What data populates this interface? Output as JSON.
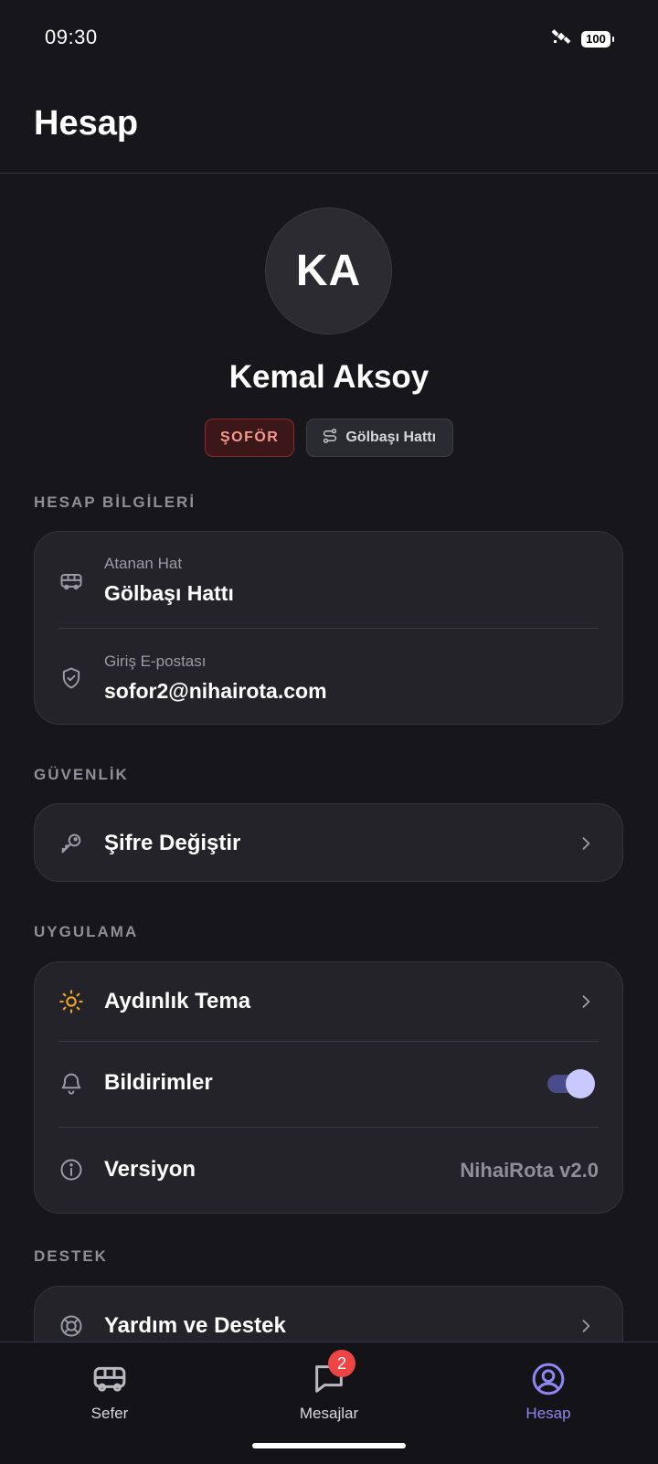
{
  "status_bar": {
    "time": "09:30",
    "battery": "100"
  },
  "header": {
    "title": "Hesap"
  },
  "profile": {
    "initials": "KA",
    "name": "Kemal Aksoy",
    "role_badge": "ŞOFÖR",
    "line_badge": "Gölbaşı Hattı"
  },
  "sections": {
    "account_info": {
      "title": "HESAP BİLGİLERİ",
      "assigned_line_label": "Atanan Hat",
      "assigned_line_value": "Gölbaşı Hattı",
      "email_label": "Giriş E-postası",
      "email_value": "sofor2@nihairota.com"
    },
    "security": {
      "title": "GÜVENLİK",
      "change_password": "Şifre Değiştir"
    },
    "app": {
      "title": "UYGULAMA",
      "light_theme": "Aydınlık Tema",
      "notifications": "Bildirimler",
      "notifications_enabled": true,
      "version_label": "Versiyon",
      "version_value": "NihaiRota v2.0"
    },
    "support": {
      "title": "DESTEK",
      "help": "Yardım ve Destek"
    }
  },
  "bottom_nav": {
    "items": [
      {
        "label": "Sefer",
        "icon": "bus-icon",
        "active": false
      },
      {
        "label": "Mesajlar",
        "icon": "message-icon",
        "active": false,
        "badge": "2"
      },
      {
        "label": "Hesap",
        "icon": "user-circle-icon",
        "active": true
      }
    ]
  },
  "colors": {
    "background": "#17171b",
    "card": "#232329",
    "accent": "#8e87f2",
    "role_badge_text": "#f39a8c",
    "theme_icon": "#f5a524",
    "notification_badge": "#ef4444"
  }
}
